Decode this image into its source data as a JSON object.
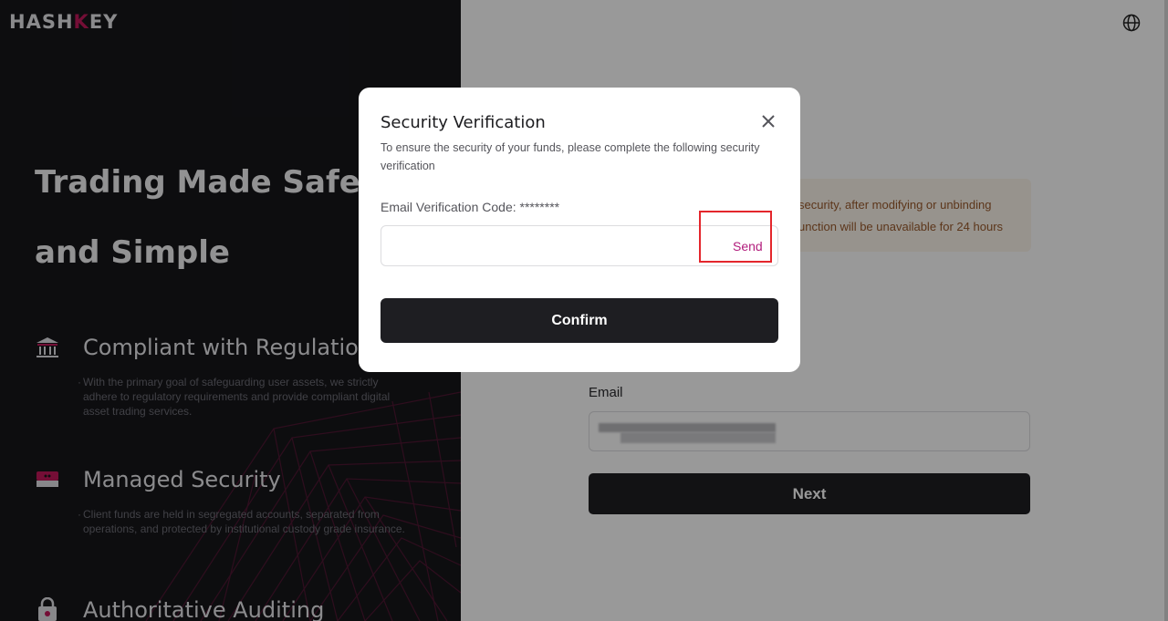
{
  "brand": {
    "logo_part1": "HASH",
    "logo_part2": "K",
    "logo_part3": "EY",
    "accent_color": "#c2185b"
  },
  "hero": {
    "headline": "Trading Made Safe and Simple"
  },
  "features": [
    {
      "icon": "bank-icon",
      "title": "Compliant with Regulations",
      "description": "With the primary goal of safeguarding user assets, we strictly adhere to regulatory requirements and provide compliant digital asset trading services."
    },
    {
      "icon": "wallet-icon",
      "title": "Managed Security",
      "description": "Client funds are held in segregated accounts, separated from operations, and protected by institutional custody grade insurance."
    },
    {
      "icon": "lock-icon",
      "title": "Authoritative Auditing",
      "description": ""
    }
  ],
  "background_form": {
    "notice_line1": "security, after modifying or unbinding",
    "notice_line2": "unction will be unavailable for 24 hours",
    "email_label": "Email",
    "email_value": "",
    "next_label": "Next"
  },
  "modal": {
    "title": "Security Verification",
    "subtitle": "To ensure the security of your funds, please complete the following security verification",
    "code_label": "Email Verification Code: ********",
    "code_value": "",
    "send_label": "Send",
    "confirm_label": "Confirm"
  },
  "colors": {
    "send_link": "#b21d7c",
    "highlight_box": "#e4262c",
    "primary_button": "#1e1e22"
  }
}
